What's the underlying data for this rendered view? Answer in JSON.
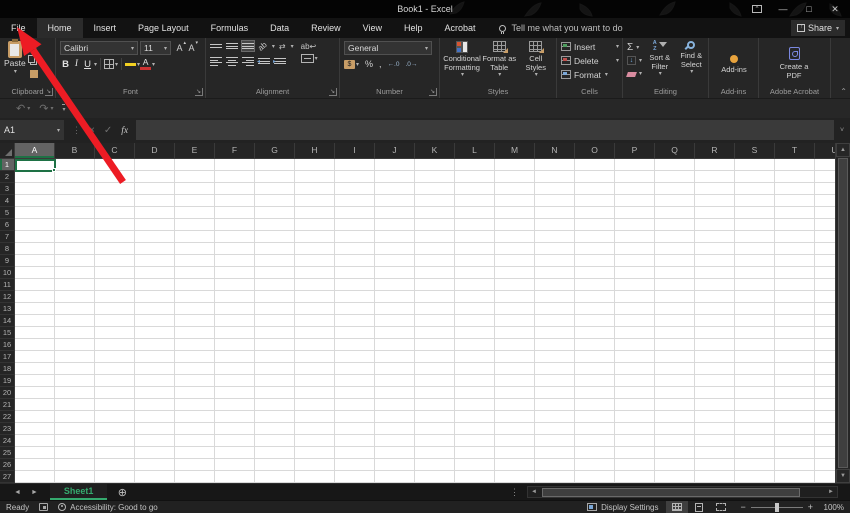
{
  "titlebar": {
    "title": "Book1 - Excel",
    "minimize": "—",
    "maximize": "□",
    "close": "✕"
  },
  "menu": {
    "tabs": [
      {
        "label": "File",
        "active": false
      },
      {
        "label": "Home",
        "active": true
      },
      {
        "label": "Insert",
        "active": false
      },
      {
        "label": "Page Layout",
        "active": false
      },
      {
        "label": "Formulas",
        "active": false
      },
      {
        "label": "Data",
        "active": false
      },
      {
        "label": "Review",
        "active": false
      },
      {
        "label": "View",
        "active": false
      },
      {
        "label": "Help",
        "active": false
      },
      {
        "label": "Acrobat",
        "active": false
      }
    ],
    "tell_me": "Tell me what you want to do",
    "share_label": "Share"
  },
  "ribbon": {
    "clipboard": {
      "paste_label": "Paste",
      "group_label": "Clipboard"
    },
    "font": {
      "font_name": "Calibri",
      "font_size": "11",
      "bold": "B",
      "italic": "I",
      "underline": "U",
      "color_letter": "A",
      "group_label": "Font"
    },
    "alignment": {
      "orientation_text": "ab",
      "wrap_text": "ab",
      "group_label": "Alignment"
    },
    "number": {
      "format": "General",
      "currency": "$",
      "percent": "%",
      "comma": ",",
      "inc_decimal": "←.0",
      "dec_decimal": ".0→",
      "group_label": "Number"
    },
    "styles": {
      "buttons": [
        "Conditional Formatting",
        "Format as Table",
        "Cell Styles"
      ],
      "group_label": "Styles"
    },
    "cells": {
      "buttons": [
        "Insert",
        "Delete",
        "Format"
      ],
      "group_label": "Cells"
    },
    "editing": {
      "autosum": "Σ",
      "sort_filter": "Sort & Filter",
      "find_select": "Find & Select",
      "group_label": "Editing"
    },
    "addins": {
      "button": "Add-ins",
      "group_label": "Add-ins"
    },
    "acrobat": {
      "button": "Create a PDF",
      "group_label": "Adobe Acrobat"
    }
  },
  "formula_bar": {
    "name_box": "A1",
    "fx": "fx"
  },
  "grid": {
    "columns": [
      "A",
      "B",
      "C",
      "D",
      "E",
      "F",
      "G",
      "H",
      "I",
      "J",
      "K",
      "L",
      "M",
      "N",
      "O",
      "P",
      "Q",
      "R",
      "S",
      "T",
      "U"
    ],
    "row_count": 27,
    "active_cell": "A1",
    "active_column": "A",
    "active_row": 1
  },
  "sheet_bar": {
    "sheets": [
      {
        "name": "Sheet1",
        "active": true
      }
    ]
  },
  "status_bar": {
    "ready": "Ready",
    "accessibility": "Accessibility: Good to go",
    "display_settings": "Display Settings",
    "zoom": "100%"
  },
  "colors": {
    "excel_green": "#1e7145",
    "sheet_tab_green": "#35aa6e",
    "arrow_red": "#ed1c24",
    "fill_yellow": "#f2d022",
    "font_color_red": "#cc3333"
  }
}
